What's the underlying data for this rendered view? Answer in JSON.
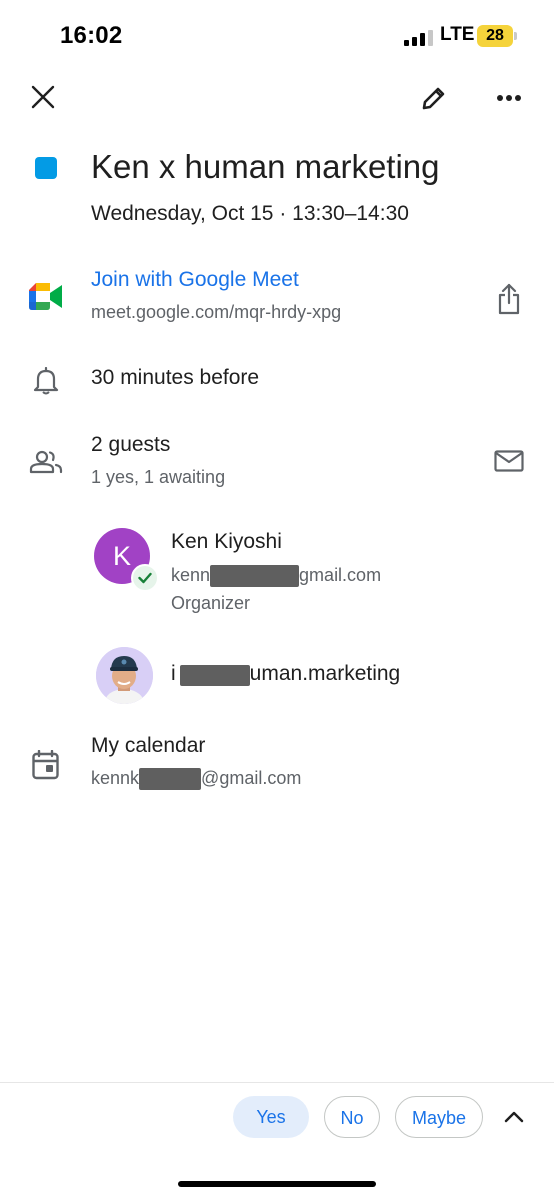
{
  "status_bar": {
    "time": "16:02",
    "network": "LTE",
    "battery": "28"
  },
  "toolbar": {
    "close_icon": "close-icon",
    "edit_icon": "pencil-icon",
    "more_icon": "more-horizontal-icon"
  },
  "event": {
    "color": "#039be5",
    "title": "Ken x human marketing",
    "datetime": "Wednesday, Oct 15 · 13:30–14:30"
  },
  "meet": {
    "label": "Join with Google Meet",
    "url": "meet.google.com/mqr-hrdy-xpg"
  },
  "notification": {
    "label": "30 minutes before"
  },
  "guests": {
    "count_label": "2 guests",
    "summary": "1 yes, 1 awaiting",
    "list": [
      {
        "initial": "K",
        "name": "Ken Kiyoshi",
        "email_start": "kenn",
        "email_end": "gmail.com",
        "role": "Organizer",
        "avatar_color": "#a142c5"
      },
      {
        "email_start": "i",
        "email_end": "uman.marketing"
      }
    ]
  },
  "calendar": {
    "label": "My calendar",
    "email_start": "kennk",
    "email_end": "@gmail.com"
  },
  "rsvp": {
    "yes": "Yes",
    "no": "No",
    "maybe": "Maybe"
  },
  "colors": {
    "accent": "#1a73e8",
    "secondary_text": "#5f6368"
  }
}
